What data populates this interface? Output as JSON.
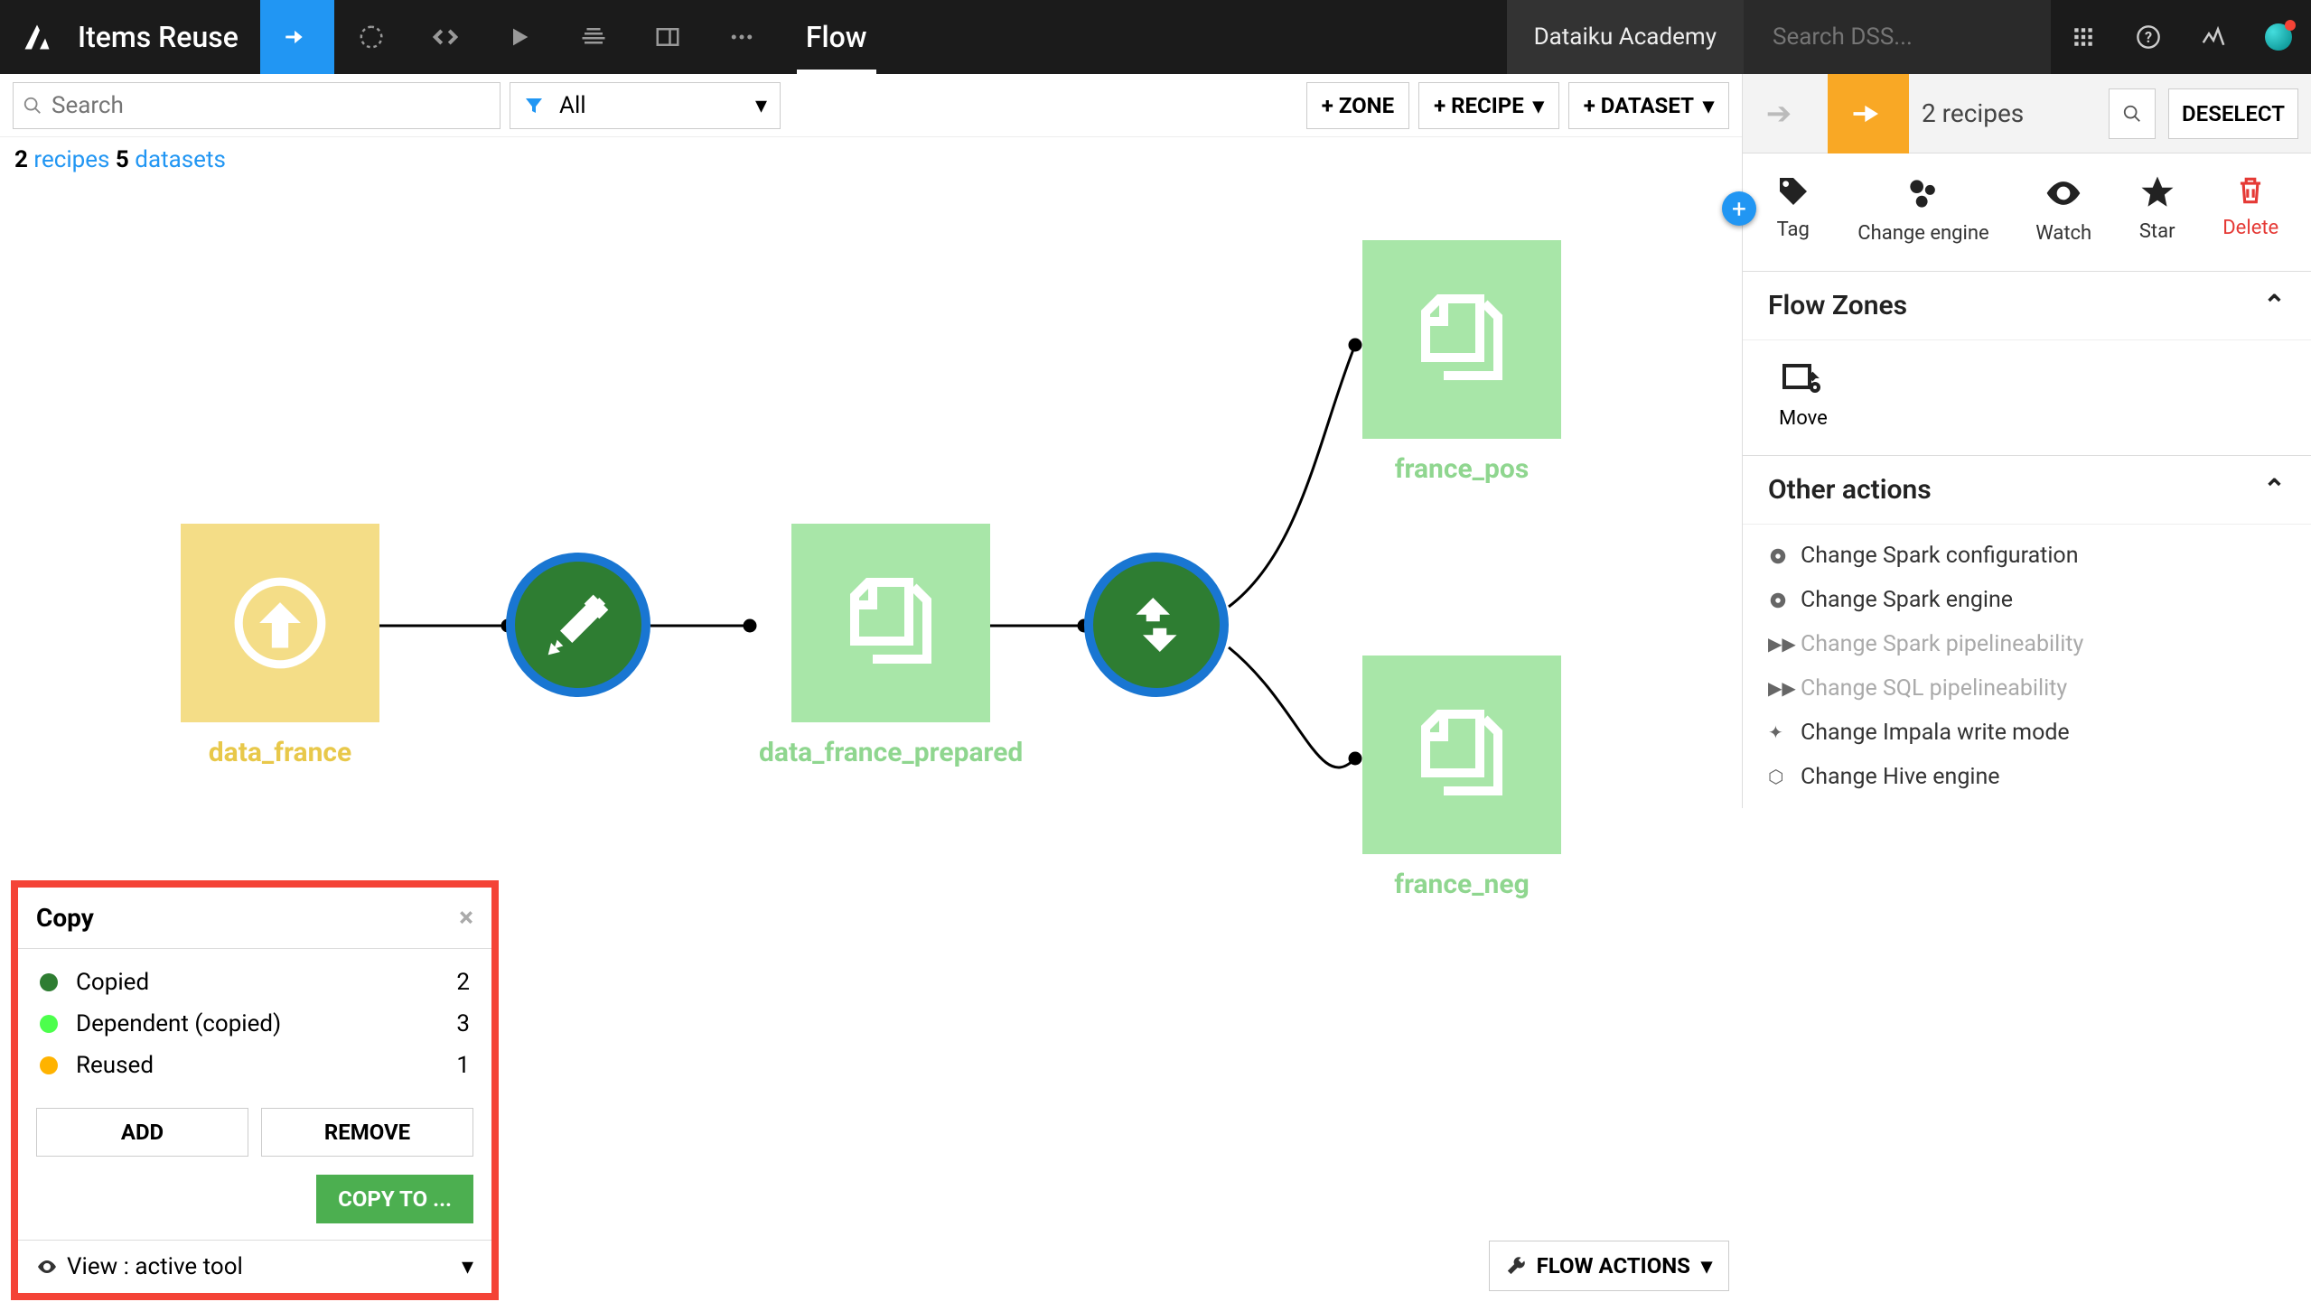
{
  "topbar": {
    "project_title": "Items Reuse",
    "active_tab": "Flow",
    "academy": "Dataiku Academy",
    "search_placeholder": "Search DSS..."
  },
  "subbar": {
    "search_placeholder": "Search",
    "filter_label": "All",
    "zone_btn": "+ ZONE",
    "recipe_btn": "+ RECIPE",
    "dataset_btn": "+ DATASET"
  },
  "summary": {
    "recipes_count": "2",
    "recipes_word": "recipes",
    "datasets_count": "5",
    "datasets_word": "datasets"
  },
  "flow_nodes": {
    "data_france": "data_france",
    "data_france_prepared": "data_france_prepared",
    "france_pos": "france_pos",
    "france_neg": "france_neg"
  },
  "copy_panel": {
    "title": "Copy",
    "rows": [
      {
        "label": "Copied",
        "count": "2",
        "color": "#2e7d32"
      },
      {
        "label": "Dependent (copied)",
        "count": "3",
        "color": "#4cff4c"
      },
      {
        "label": "Reused",
        "count": "1",
        "color": "#ffb300"
      }
    ],
    "add_btn": "ADD",
    "remove_btn": "REMOVE",
    "copy_to_btn": "COPY TO ...",
    "view_label": "View : active tool"
  },
  "flow_actions": "FLOW ACTIONS",
  "right_panel": {
    "header_count": "2 recipes",
    "deselect": "DESELECT",
    "tools": {
      "tag": "Tag",
      "change_engine": "Change engine",
      "watch": "Watch",
      "star": "Star",
      "delete": "Delete"
    },
    "sections": {
      "flow_zones": "Flow Zones",
      "move": "Move",
      "other_actions": "Other actions"
    },
    "other_actions": [
      {
        "label": "Change Spark configuration",
        "icon": "gear",
        "enabled": true
      },
      {
        "label": "Change Spark engine",
        "icon": "gear",
        "enabled": true
      },
      {
        "label": "Change Spark pipelineability",
        "icon": "ff",
        "enabled": false
      },
      {
        "label": "Change SQL pipelineability",
        "icon": "ff",
        "enabled": false
      },
      {
        "label": "Change Impala write mode",
        "icon": "impala",
        "enabled": true
      },
      {
        "label": "Change Hive engine",
        "icon": "hive",
        "enabled": true
      }
    ]
  }
}
